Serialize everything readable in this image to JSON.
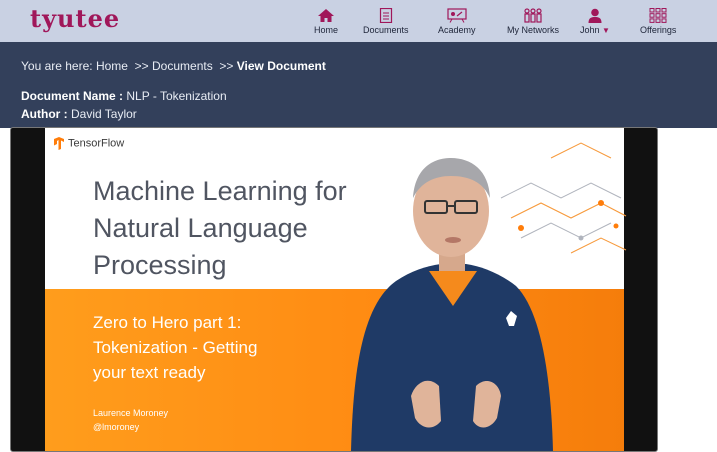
{
  "brand": {
    "logo_text": "tyutee",
    "accent": "#a0175a"
  },
  "nav": {
    "items": [
      {
        "label": "Home",
        "icon": "home-icon"
      },
      {
        "label": "Documents",
        "icon": "document-icon"
      },
      {
        "label": "Academy",
        "icon": "academy-icon"
      },
      {
        "label": "My Networks",
        "icon": "network-icon"
      },
      {
        "label": "John",
        "icon": "user-icon"
      },
      {
        "label": "Offerings",
        "icon": "grid-icon"
      }
    ]
  },
  "breadcrumb": {
    "prefix": "You are here:",
    "home": "Home",
    "sep1": ">>",
    "documents": "Documents",
    "sep2": ">>",
    "current": "View Document"
  },
  "document": {
    "name_label": "Document Name :",
    "name_value": "NLP - Tokenization",
    "author_label": "Author :",
    "author_value": "David Taylor"
  },
  "slide": {
    "brand": "TensorFlow",
    "title_lines": [
      "Machine Learning for",
      "Natural Language",
      "Processing"
    ],
    "subtitle_lines": [
      "Zero to Hero part 1:",
      "Tokenization - Getting",
      "your text ready"
    ],
    "presenter_name": "Laurence Moroney",
    "presenter_handle": "@lmoroney"
  }
}
